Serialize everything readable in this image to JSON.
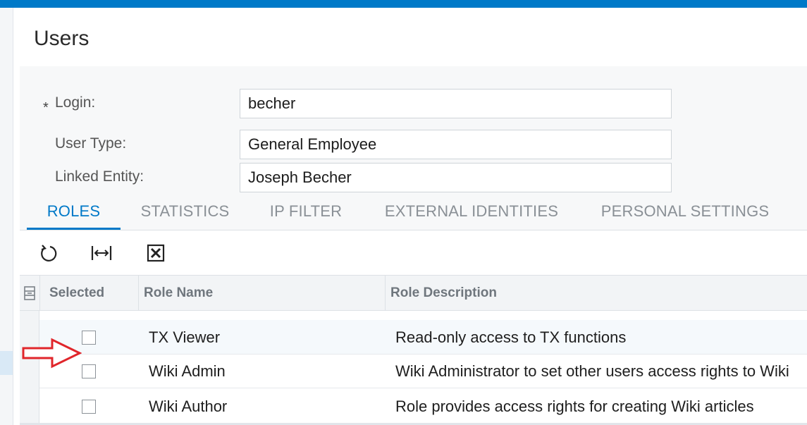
{
  "page": {
    "title": "Users"
  },
  "form": {
    "login_label": "Login:",
    "login_required_mark": "*",
    "login_value": "becher",
    "user_type_label": "User Type:",
    "user_type_value": "General Employee",
    "linked_entity_label": "Linked Entity:",
    "linked_entity_value": "Joseph Becher"
  },
  "tabs": [
    {
      "label": "ROLES",
      "active": true
    },
    {
      "label": "STATISTICS",
      "active": false
    },
    {
      "label": "IP FILTER",
      "active": false
    },
    {
      "label": "EXTERNAL IDENTITIES",
      "active": false
    },
    {
      "label": "PERSONAL SETTINGS",
      "active": false
    }
  ],
  "toolbar": {
    "icons": [
      "refresh-icon",
      "fit-columns-icon",
      "export-excel-icon"
    ]
  },
  "grid": {
    "columns": [
      "Selected",
      "Role Name",
      "Role Description"
    ],
    "rows": [
      {
        "selected": false,
        "role_name": "TX Viewer",
        "role_description": "Read-only access to TX functions"
      },
      {
        "selected": false,
        "role_name": "Wiki Admin",
        "role_description": "Wiki Administrator to set other users access rights to Wiki"
      },
      {
        "selected": false,
        "role_name": "Wiki Author",
        "role_description": "Role provides access rights for creating Wiki articles"
      }
    ]
  },
  "colors": {
    "accent": "#0079c8",
    "annotation_arrow": "#e0262b"
  }
}
